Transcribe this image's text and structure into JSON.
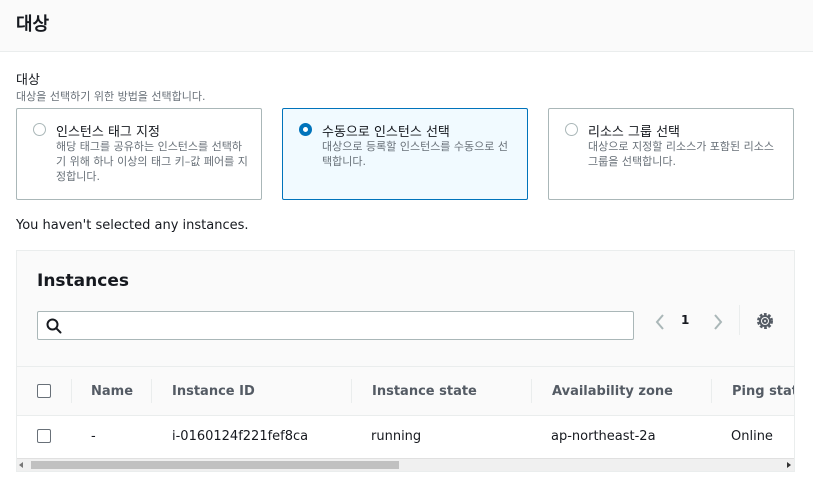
{
  "header": {
    "title": "대상"
  },
  "target": {
    "label": "대상",
    "description": "대상을 선택하기 위한 방법을 선택합니다."
  },
  "options": [
    {
      "title": "인스턴스 태그 지정",
      "description": "해당 태그를 공유하는 인스턴스를 선택하기 위해 하나 이상의 태그 키–값 페어를 지정합니다.",
      "selected": false
    },
    {
      "title": "수동으로 인스턴스 선택",
      "description": "대상으로 등록할 인스턴스를 수동으로 선택합니다.",
      "selected": true
    },
    {
      "title": "리소스 그룹 선택",
      "description": "대상으로 지정할 리소스가 포함된 리소스 그룹을 선택합니다.",
      "selected": false
    }
  ],
  "notice": "You haven't selected any instances.",
  "instances": {
    "title": "Instances",
    "search_placeholder": "",
    "page": "1",
    "columns": [
      "Name",
      "Instance ID",
      "Instance state",
      "Availability zone",
      "Ping statu"
    ],
    "rows": [
      {
        "name": "-",
        "instance_id": "i-0160124f221fef8ca",
        "state": "running",
        "az": "ap-northeast-2a",
        "ping": "Online"
      }
    ]
  },
  "colors": {
    "accent": "#0073bb",
    "selected_bg": "#f1faff",
    "muted_text": "#687078"
  },
  "icons": [
    "search-icon",
    "chevron-left-icon",
    "chevron-right-icon",
    "gear-icon"
  ]
}
